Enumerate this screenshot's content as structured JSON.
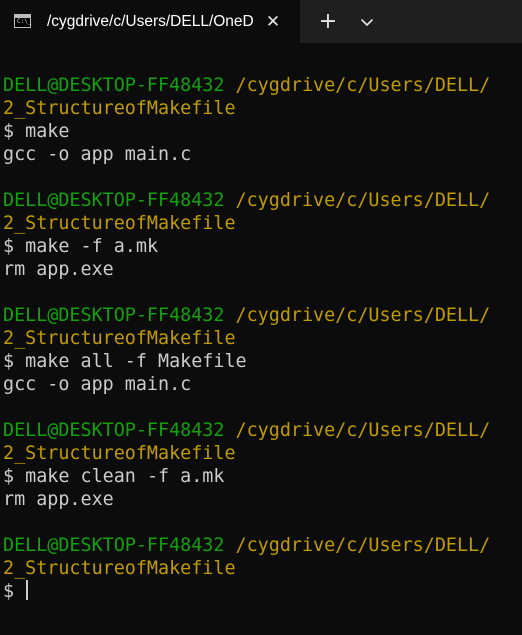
{
  "colors": {
    "background": "#0c0c0c",
    "tab_bar": "#1f1f1f",
    "user_host": "#13a10e",
    "path": "#c19c00",
    "text": "#cccccc"
  },
  "tab": {
    "icon": "terminal-icon",
    "title": "/cygdrive/c/Users/DELL/OneD",
    "close_symbol": "✕"
  },
  "toolbar": {
    "new_tab_symbol": "+",
    "dropdown_icon": "chevron-down-icon"
  },
  "terminal": {
    "blocks": [
      {
        "user_host": "DELL@DESKTOP-FF48432",
        "path": "/cygdrive/c/Users/DELL/",
        "path_cont": "2_StructureofMakefile",
        "prompt": "$ ",
        "command": "make",
        "output": "gcc -o app main.c"
      },
      {
        "user_host": "DELL@DESKTOP-FF48432",
        "path": "/cygdrive/c/Users/DELL/",
        "path_cont": "2_StructureofMakefile",
        "prompt": "$ ",
        "command": "make -f a.mk",
        "output": "rm app.exe"
      },
      {
        "user_host": "DELL@DESKTOP-FF48432",
        "path": "/cygdrive/c/Users/DELL/",
        "path_cont": "2_StructureofMakefile",
        "prompt": "$ ",
        "command": "make all -f Makefile",
        "output": "gcc -o app main.c"
      },
      {
        "user_host": "DELL@DESKTOP-FF48432",
        "path": "/cygdrive/c/Users/DELL/",
        "path_cont": "2_StructureofMakefile",
        "prompt": "$ ",
        "command": "make clean -f a.mk",
        "output": "rm app.exe"
      }
    ],
    "current": {
      "user_host": "DELL@DESKTOP-FF48432",
      "path": "/cygdrive/c/Users/DELL/",
      "path_cont": "2_StructureofMakefile",
      "prompt": "$ "
    }
  }
}
